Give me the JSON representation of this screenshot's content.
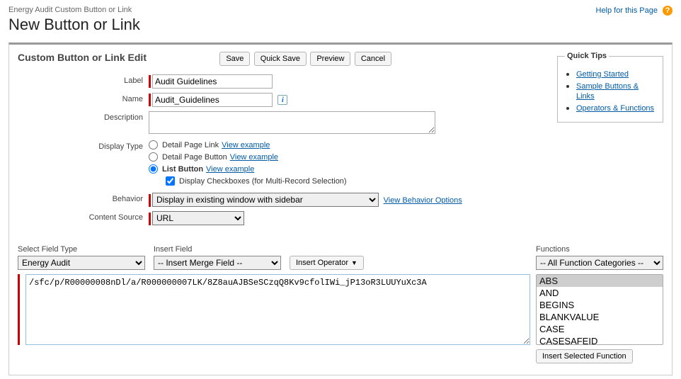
{
  "header": {
    "breadcrumb": "Energy Audit Custom Button or Link",
    "title": "New Button or Link",
    "help_text": "Help for this Page"
  },
  "section": {
    "title": "Custom Button or Link Edit",
    "buttons": {
      "save": "Save",
      "quick_save": "Quick Save",
      "preview": "Preview",
      "cancel": "Cancel"
    }
  },
  "quick_tips": {
    "legend": "Quick Tips",
    "items": [
      "Getting Started",
      "Sample Buttons & Links",
      "Operators & Functions"
    ]
  },
  "form": {
    "label_lbl": "Label",
    "label_val": "Audit Guidelines",
    "name_lbl": "Name",
    "name_val": "Audit_Guidelines",
    "desc_lbl": "Description",
    "desc_val": "",
    "display_type_lbl": "Display Type",
    "dt_opts": {
      "link": "Detail Page Link",
      "button": "Detail Page Button",
      "list": "List Button"
    },
    "view_example": "View example",
    "checkbox_lbl": "Display Checkboxes (for Multi-Record Selection)",
    "behavior_lbl": "Behavior",
    "behavior_val": "Display in existing window with sidebar",
    "behavior_link": "View Behavior Options",
    "content_source_lbl": "Content Source",
    "content_source_val": "URL"
  },
  "lower": {
    "field_type_lbl": "Select Field Type",
    "field_type_val": "Energy Audit",
    "insert_field_lbl": "Insert Field",
    "insert_field_val": "-- Insert Merge Field --",
    "insert_operator": "Insert Operator",
    "functions_lbl": "Functions",
    "functions_cat": "-- All Function Categories --",
    "functions_list": [
      "ABS",
      "AND",
      "BEGINS",
      "BLANKVALUE",
      "CASE",
      "CASESAFEID"
    ],
    "insert_selected_fn": "Insert Selected Function",
    "editor_val": "/sfc/p/R00000008nDl/a/R000000007LK/8Z8auAJBSeSCzqQ8Kv9cfolIWi_jP13oR3LUUYuXc3A"
  }
}
